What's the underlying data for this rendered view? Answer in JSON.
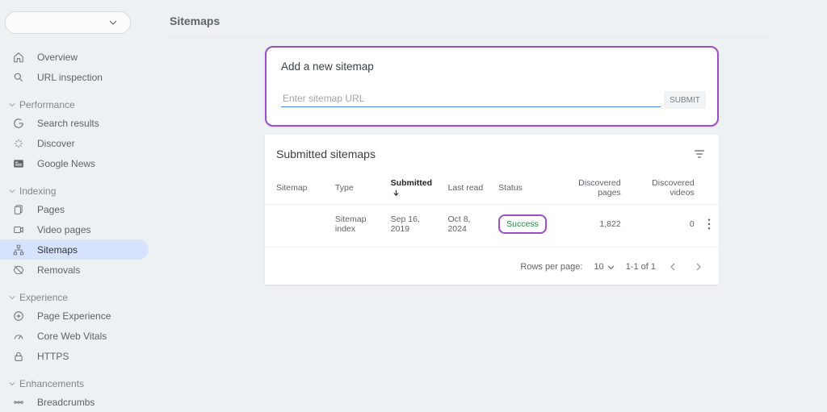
{
  "page": {
    "title": "Sitemaps"
  },
  "nav": {
    "top": [
      {
        "key": "overview",
        "label": "Overview",
        "icon": "home-icon"
      },
      {
        "key": "url-inspection",
        "label": "URL inspection",
        "icon": "search-icon"
      }
    ],
    "groups": [
      {
        "title": "Performance",
        "items": [
          {
            "key": "search-results",
            "label": "Search results",
            "icon": "g-icon"
          },
          {
            "key": "discover",
            "label": "Discover",
            "icon": "sparkle-icon"
          },
          {
            "key": "google-news",
            "label": "Google News",
            "icon": "news-icon"
          }
        ]
      },
      {
        "title": "Indexing",
        "items": [
          {
            "key": "pages",
            "label": "Pages",
            "icon": "pages-icon"
          },
          {
            "key": "video-pages",
            "label": "Video pages",
            "icon": "video-icon"
          },
          {
            "key": "sitemaps",
            "label": "Sitemaps",
            "icon": "sitemap-icon",
            "active": true
          },
          {
            "key": "removals",
            "label": "Removals",
            "icon": "removals-icon"
          }
        ]
      },
      {
        "title": "Experience",
        "items": [
          {
            "key": "page-experience",
            "label": "Page Experience",
            "icon": "plus-circle-icon"
          },
          {
            "key": "core-web-vitals",
            "label": "Core Web Vitals",
            "icon": "gauge-icon"
          },
          {
            "key": "https",
            "label": "HTTPS",
            "icon": "lock-icon"
          }
        ]
      },
      {
        "title": "Enhancements",
        "items": [
          {
            "key": "breadcrumbs",
            "label": "Breadcrumbs",
            "icon": "breadcrumb-icon"
          }
        ]
      }
    ]
  },
  "addSitemap": {
    "heading": "Add a new sitemap",
    "placeholder": "Enter sitemap URL",
    "submitLabel": "SUBMIT"
  },
  "submitted": {
    "heading": "Submitted sitemaps",
    "columns": {
      "sitemap": "Sitemap",
      "type": "Type",
      "submitted": "Submitted",
      "lastRead": "Last read",
      "status": "Status",
      "discoveredPages": "Discovered pages",
      "discoveredVideos": "Discovered videos"
    },
    "rows": [
      {
        "sitemap": "",
        "type": "Sitemap index",
        "submitted": "Sep 16, 2019",
        "lastRead": "Oct 8, 2024",
        "status": "Success",
        "discoveredPages": "1,822",
        "discoveredVideos": "0"
      }
    ]
  },
  "pagination": {
    "rowsPerPageLabel": "Rows per page:",
    "rowsPerPage": "10",
    "range": "1-1 of 1"
  }
}
